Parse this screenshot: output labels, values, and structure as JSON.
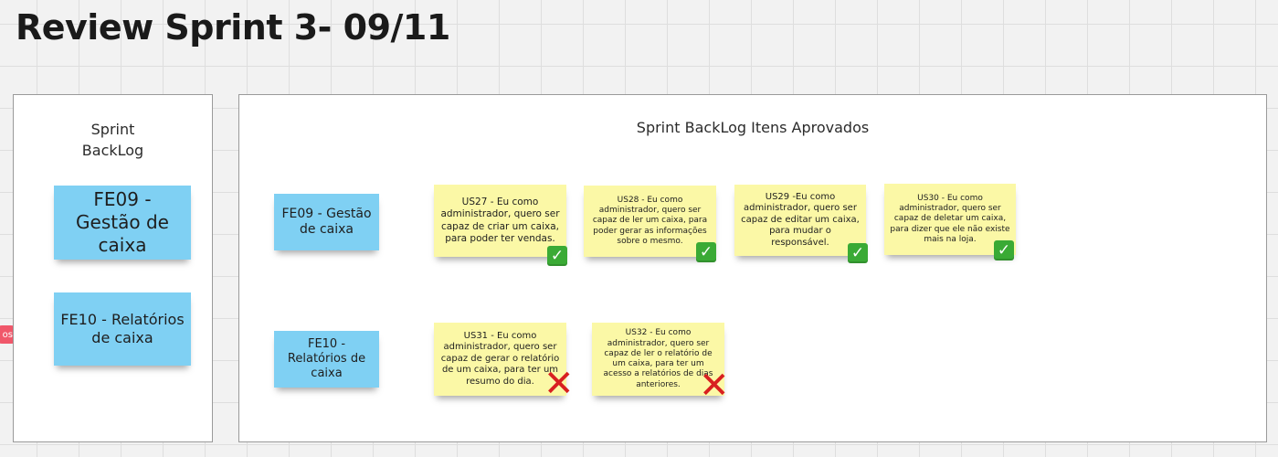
{
  "board": {
    "title": "Review Sprint 3- 09/11",
    "side_tag": "os"
  },
  "frames": {
    "backlog": {
      "title_line1": "Sprint",
      "title_line2": "BackLog",
      "notes": [
        "FE09 - Gestão de caixa",
        "FE10 - Relatórios de caixa"
      ]
    },
    "approved": {
      "title": "Sprint BackLog Itens Aprovados",
      "features": [
        "FE09 - Gestão de caixa",
        "FE10 - Relatórios de caixa"
      ],
      "stories": [
        {
          "text": "US27 - Eu como administrador, quero ser capaz de criar um caixa, para poder ter vendas.",
          "status": "approved"
        },
        {
          "text": "US28 - Eu como administrador, quero ser capaz de ler um caixa, para poder gerar as informações sobre o mesmo.",
          "status": "approved"
        },
        {
          "text": "US29 -Eu como administrador, quero ser capaz de editar um caixa, para mudar o responsável.",
          "status": "approved"
        },
        {
          "text": "US30 - Eu como administrador, quero ser capaz de deletar um caixa, para dizer que ele não existe mais na loja.",
          "status": "approved"
        },
        {
          "text": "US31 - Eu como administrador, quero ser capaz de gerar o relatório de um caixa, para ter um resumo do dia.",
          "status": "rejected"
        },
        {
          "text": "US32 - Eu como administrador, quero ser capaz de ler o relatório de um caixa, para ter um acesso a relatórios de dias anteriores.",
          "status": "rejected"
        }
      ]
    }
  },
  "icons": {
    "check": "check-mark-icon",
    "cross": "cross-mark-icon",
    "check_color": "#3aaa35",
    "cross_color": "#d82020"
  },
  "colors": {
    "feature_note": "#7fd0f3",
    "story_note": "#fbf8a6"
  }
}
